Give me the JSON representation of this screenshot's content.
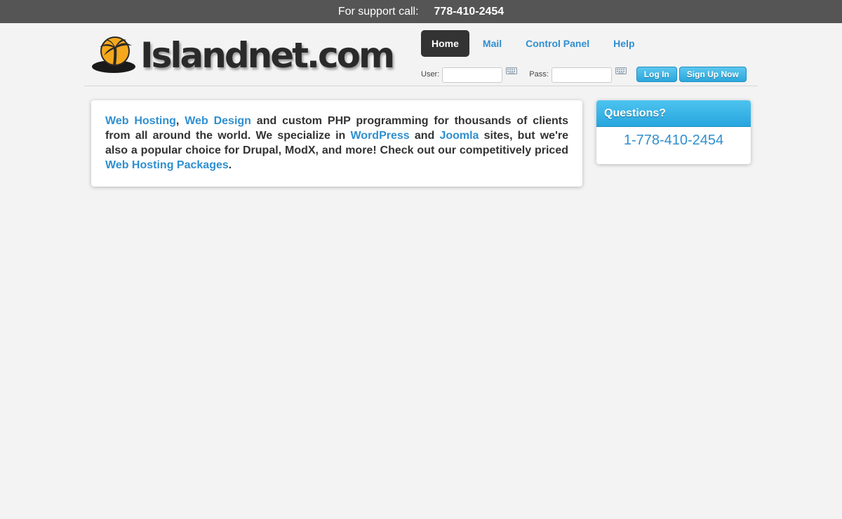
{
  "topbar": {
    "support_label": "For support call:",
    "support_phone": "778-410-2454"
  },
  "logo": {
    "text": "Islandnet.com",
    "icon": "palm-island-icon"
  },
  "nav": {
    "items": [
      "Home",
      "Mail",
      "Control Panel",
      "Help"
    ],
    "active": "Home"
  },
  "login": {
    "user_label": "User:",
    "user_value": "",
    "pass_label": "Pass:",
    "pass_value": "",
    "keyboard_icon": "keyboard-icon",
    "login_button": "Log In",
    "signup_button": "Sign Up Now"
  },
  "intro": {
    "parts": [
      {
        "text": "Web Hosting",
        "link": true
      },
      {
        "text": ", ",
        "link": false
      },
      {
        "text": "Web Design",
        "link": true
      },
      {
        "text": " and custom PHP programming for thousands of clients from all around the world. We specialize in ",
        "link": false
      },
      {
        "text": "WordPress",
        "link": true
      },
      {
        "text": " and ",
        "link": false
      },
      {
        "text": "Joomla",
        "link": true
      },
      {
        "text": " sites, but we're also a popular choice for Drupal, ModX, and more! Check out our competitively priced ",
        "link": false
      },
      {
        "text": "Web Hosting Packages",
        "link": true
      },
      {
        "text": ".",
        "link": false
      }
    ]
  },
  "questions": {
    "title": "Questions?",
    "phone": "1-778-410-2454"
  },
  "colors": {
    "topbar": "#555555",
    "link": "#2f8fd0",
    "accent": "#27a5de",
    "background": "#f3f3f3"
  }
}
